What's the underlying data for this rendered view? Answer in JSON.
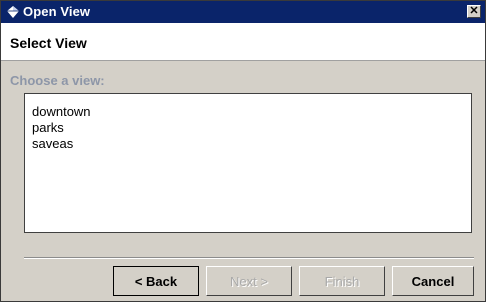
{
  "window": {
    "title": "Open View",
    "close_glyph": "✕"
  },
  "header": {
    "title": "Select View"
  },
  "main": {
    "prompt": "Choose a view:",
    "views": [
      "downtown",
      "parks",
      "saveas"
    ]
  },
  "buttons": {
    "back": "< Back",
    "next": "Next >",
    "finish": "Finish",
    "cancel": "Cancel"
  },
  "colors": {
    "titlebar": "#0a246a",
    "dialog_bg": "#d4d0c8",
    "prompt_text": "#8d96a8"
  },
  "icons": {
    "title": "app-diamond-icon",
    "close": "close-icon"
  }
}
